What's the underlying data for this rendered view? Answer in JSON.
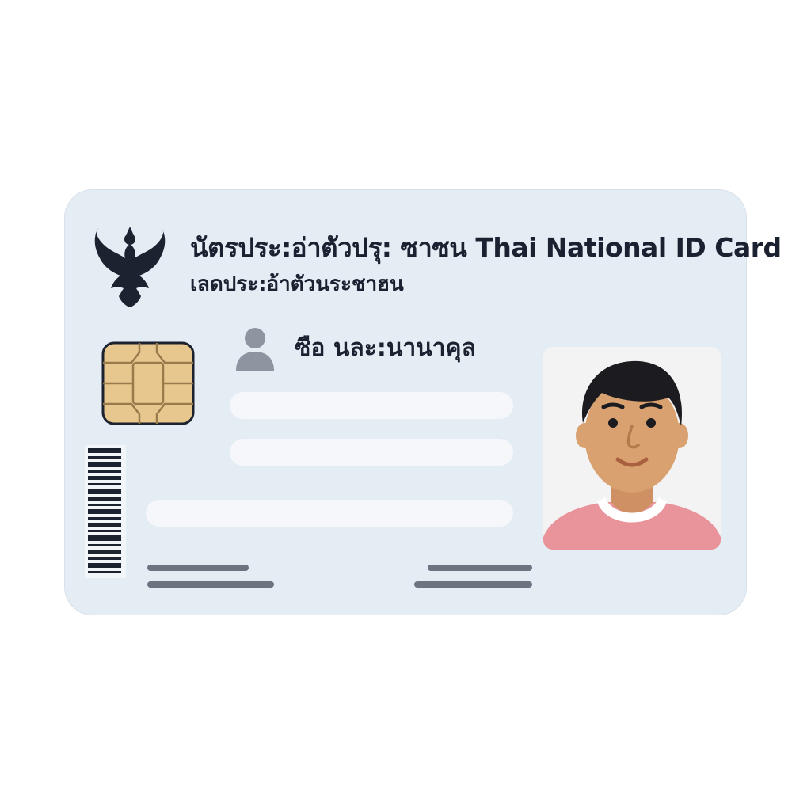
{
  "card": {
    "title": "นัตรประ:อ่าตัวปรุ: ซาซน Thai National ID Card",
    "subtitle": "เลดประ:อ้าตัวนระชาฮน",
    "name_label": "ซือ นละ:นานาคุล"
  },
  "icons": {
    "emblem": "garuda-emblem-icon",
    "chip": "smart-card-chip-icon",
    "person": "person-icon",
    "barcode": "barcode-icon"
  },
  "colors": {
    "card_background": "#e4ecf4",
    "text": "#1b2130",
    "chip": "#e8c78f",
    "shirt": "#e8949a",
    "skin": "#d8a16f",
    "field": "#f5f7fa",
    "line": "#6b7480"
  }
}
